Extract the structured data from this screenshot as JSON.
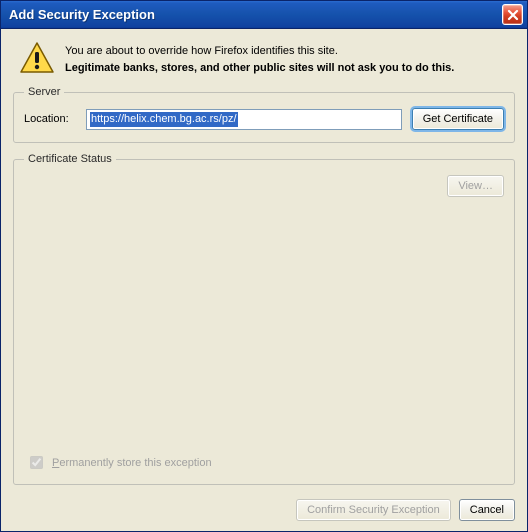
{
  "titlebar": {
    "title": "Add Security Exception"
  },
  "warning": {
    "line1": "You are about to override how Firefox identifies this site.",
    "line2": "Legitimate banks, stores, and other public sites will not ask you to do this."
  },
  "server": {
    "legend": "Server",
    "location_label": "Location:",
    "url": "https://helix.chem.bg.ac.rs/pz/",
    "get_cert_label": "Get Certificate"
  },
  "cert_status": {
    "legend": "Certificate Status",
    "view_label": "View…"
  },
  "permanent": {
    "label": "Permanently store this exception",
    "checked": true,
    "enabled": false
  },
  "footer": {
    "confirm_label": "Confirm Security Exception",
    "cancel_label": "Cancel"
  }
}
